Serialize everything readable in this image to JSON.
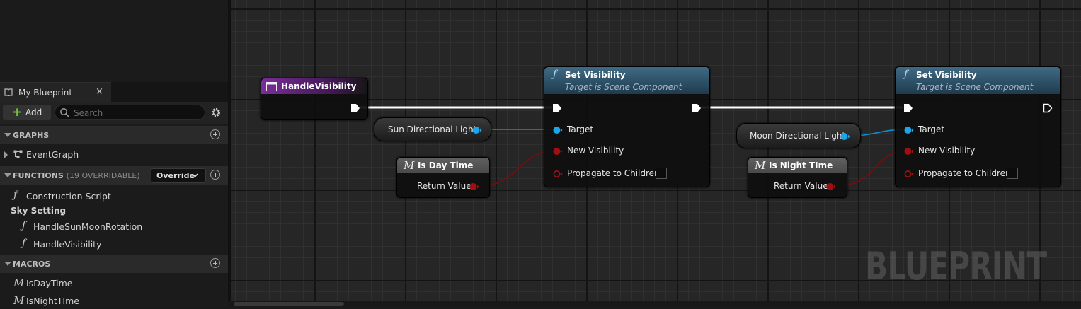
{
  "panel": {
    "tab_label": "My Blueprint",
    "close_symbol": "×",
    "add_label": "Add",
    "search_placeholder": "Search",
    "sections": {
      "graphs": "GRAPHS",
      "functions": "FUNCTIONS",
      "functions_sub": "(19 OVERRIDABLE)",
      "override_label": "Override",
      "macros": "MACROS"
    },
    "graphs": [
      "EventGraph"
    ],
    "functions": {
      "construction": "Construction Script",
      "category": "Sky Setting",
      "items": [
        "HandleSunMoonRotation",
        "HandleVisibility"
      ]
    },
    "macros": [
      "IsDayTime",
      "IsNightTIme"
    ]
  },
  "graph": {
    "event_node": {
      "title": "HandleVisibility"
    },
    "set_visibility_1": {
      "title": "Set Visibility",
      "subtitle": "Target is Scene Component",
      "pins": {
        "target": "Target",
        "new_visibility": "New Visibility",
        "propagate": "Propagate to Children"
      }
    },
    "set_visibility_2": {
      "title": "Set Visibility",
      "subtitle": "Target is Scene Component",
      "pins": {
        "target": "Target",
        "new_visibility": "New Visibility",
        "propagate": "Propagate to Children"
      }
    },
    "sun_var": "Sun Directional Light",
    "moon_var": "Moon Directional Light",
    "day_macro": {
      "title": "Is Day Time",
      "output": "Return Value"
    },
    "night_macro": {
      "title": "Is Night TIme",
      "output": "Return Value"
    },
    "watermark": "BLUEPRINT",
    "colors": {
      "event_header": "#6a2a8a",
      "function_header": "#2b4f66",
      "exec_wire": "#ffffff",
      "object_pin": "#1aa6e8",
      "bool_pin": "#a01010"
    }
  }
}
